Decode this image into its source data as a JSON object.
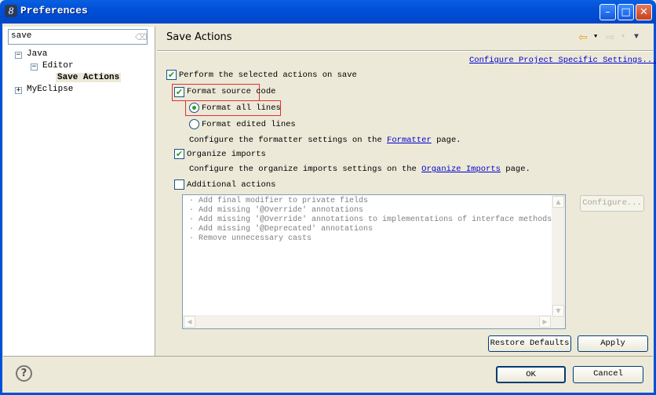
{
  "window": {
    "title": "Preferences",
    "minimize": "–",
    "maximize": "□",
    "close": "✕"
  },
  "sidebar": {
    "search_value": "save",
    "tree": [
      {
        "label": "Java",
        "expander": "−"
      },
      {
        "label": "Editor",
        "expander": "−"
      },
      {
        "label": "Save Actions"
      },
      {
        "label": "MyEclipse",
        "expander": "+"
      }
    ]
  },
  "page": {
    "title": "Save Actions",
    "project_link": "Configure Project Specific Settings...",
    "perform": {
      "label": "Perform the selected actions on save",
      "checked": true
    },
    "format_source": {
      "label": "Format source code",
      "checked": true
    },
    "format_all": {
      "label": "Format all lines",
      "selected": true
    },
    "format_edited": {
      "label": "Format edited lines",
      "selected": false
    },
    "formatter_text": {
      "pre": "Configure the formatter settings on the ",
      "link": "Formatter",
      "post": " page."
    },
    "organize": {
      "label": "Organize imports",
      "checked": true
    },
    "organize_text": {
      "pre": "Configure the organize imports settings on the ",
      "link": "Organize Imports",
      "post": " page."
    },
    "additional": {
      "label": "Additional actions",
      "checked": false
    },
    "additional_items": [
      "Add final modifier to private fields",
      "Add missing '@Override' annotations",
      "Add missing '@Override' annotations to implementations of interface methods",
      "Add missing '@Deprecated' annotations",
      "Remove unnecessary casts"
    ],
    "configure_button": "Configure...",
    "restore_button": "Restore Defaults",
    "apply_button": "Apply"
  },
  "footer": {
    "ok": "OK",
    "cancel": "Cancel",
    "help": "?"
  },
  "colors": {
    "titlebar": "#0050d8",
    "highlight_box": "#e03030",
    "check": "#21a121",
    "link": "#0000cc"
  }
}
